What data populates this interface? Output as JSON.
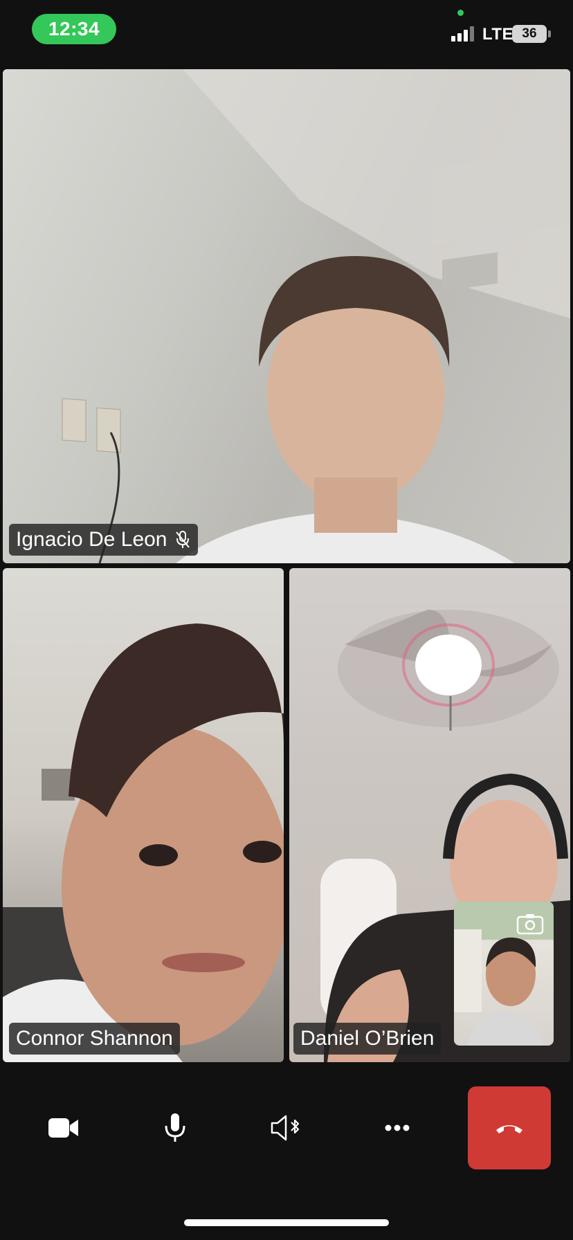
{
  "status_bar": {
    "time": "12:34",
    "network": "LTE",
    "battery": "36"
  },
  "participants": [
    {
      "name": "Ignacio De Leon",
      "muted": true
    },
    {
      "name": "Connor Shannon",
      "muted": false
    },
    {
      "name": "Daniel O’Brien",
      "muted": false
    }
  ],
  "self_view": {
    "icon": "switch-camera-icon"
  },
  "controls": {
    "items": [
      {
        "icon": "video-camera-icon"
      },
      {
        "icon": "microphone-icon"
      },
      {
        "icon": "speaker-bluetooth-icon"
      },
      {
        "icon": "more-options-icon"
      },
      {
        "icon": "end-call-icon"
      }
    ]
  },
  "colors": {
    "background": "#111111",
    "time_pill": "#34c759",
    "end_call": "#d03a34",
    "name_tag": "#222222"
  }
}
